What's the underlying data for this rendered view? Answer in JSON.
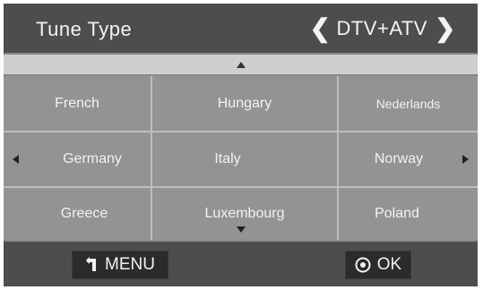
{
  "header": {
    "title": "Tune Type",
    "selector_value": "DTV+ATV",
    "prev_glyph": "❮",
    "next_glyph": "❯"
  },
  "countries": [
    [
      "French",
      "Hungary",
      "Nederlands"
    ],
    [
      "Germany",
      "Italy",
      "Norway"
    ],
    [
      "Greece",
      "Luxembourg",
      "Poland"
    ]
  ],
  "footer": {
    "menu_label": "MENU",
    "ok_label": "OK"
  },
  "icons": {
    "menu": "return-arrow-icon",
    "ok": "circle-dot-icon",
    "scroll_up": "triangle-up-icon",
    "scroll_down": "triangle-down-icon",
    "page_left": "triangle-left-icon",
    "page_right": "triangle-right-icon"
  },
  "colors": {
    "header_bg": "#4d4d4d",
    "grid_bg": "#939393",
    "button_bg": "#2b2b2b",
    "text": "#f2f2f2"
  }
}
